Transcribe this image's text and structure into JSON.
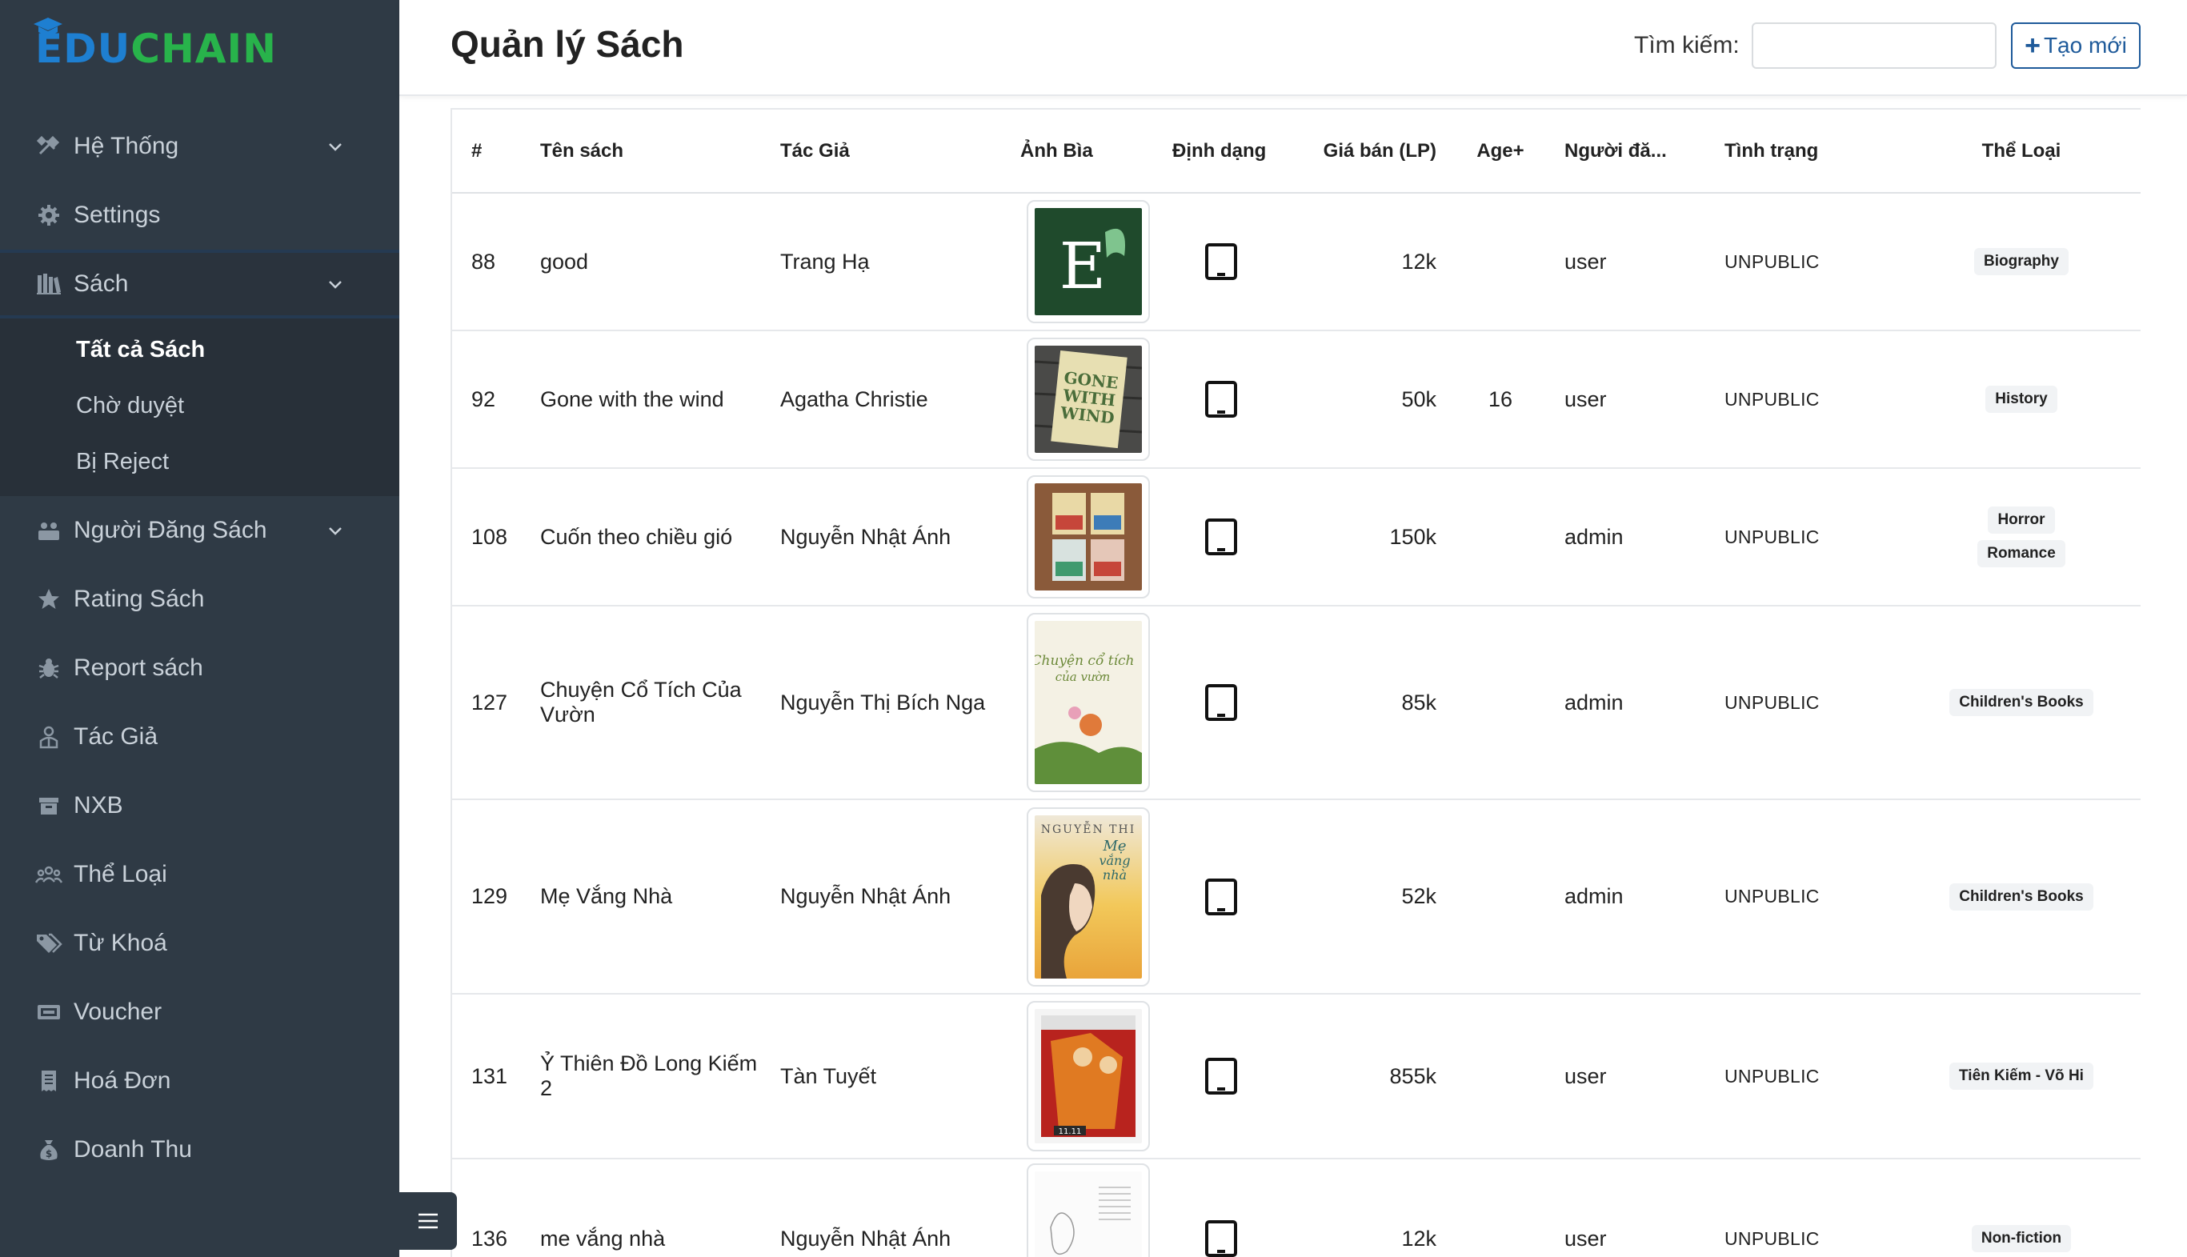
{
  "app": {
    "logo_edu": "EDU",
    "logo_chain": "CHAIN",
    "colors": {
      "sidebar_bg": "#2f3a45",
      "brand_blue": "#1e7fd1",
      "brand_green": "#28b34b",
      "button_border": "#1e5a9a"
    }
  },
  "sidebar": {
    "items": [
      {
        "label": "Hệ Thống",
        "icon": "tools-icon",
        "has_children": true
      },
      {
        "label": "Settings",
        "icon": "gear-icon",
        "has_children": false
      },
      {
        "label": "Sách",
        "icon": "books-icon",
        "has_children": true,
        "open": true,
        "children": [
          {
            "label": "Tất cả Sách",
            "active": true
          },
          {
            "label": "Chờ duyệt",
            "active": false
          },
          {
            "label": "Bị Reject",
            "active": false
          }
        ]
      },
      {
        "label": "Người Đăng Sách",
        "icon": "user-group-icon",
        "has_children": true
      },
      {
        "label": "Rating Sách",
        "icon": "star-icon",
        "has_children": false
      },
      {
        "label": "Report sách",
        "icon": "bug-icon",
        "has_children": false
      },
      {
        "label": "Tác Giả",
        "icon": "author-icon",
        "has_children": false
      },
      {
        "label": "NXB",
        "icon": "archive-icon",
        "has_children": false
      },
      {
        "label": "Thể Loại",
        "icon": "people-icon",
        "has_children": false
      },
      {
        "label": "Từ Khoá",
        "icon": "tags-icon",
        "has_children": false
      },
      {
        "label": "Voucher",
        "icon": "voucher-icon",
        "has_children": false
      },
      {
        "label": "Hoá Đơn",
        "icon": "receipt-icon",
        "has_children": false
      },
      {
        "label": "Doanh Thu",
        "icon": "money-bag-icon",
        "has_children": false
      }
    ]
  },
  "header": {
    "title": "Quản lý Sách",
    "search_label": "Tìm kiếm:",
    "search_value": "",
    "create_label": "Tạo mới"
  },
  "table": {
    "columns": [
      "#",
      "Tên sách",
      "Tác Giả",
      "Ảnh Bìa",
      "Định dạng",
      "Giá bán (LP)",
      "Age+",
      "Người đă...",
      "Tình trạng",
      "Thể Loại"
    ],
    "rows": [
      {
        "id": "88",
        "title": "good",
        "author": "Trang Hạ",
        "cover_icon": "book-cover-image",
        "format_icon": "tablet-icon",
        "price": "12k",
        "age": "",
        "uploader": "user",
        "status": "UNPUBLIC",
        "genres": [
          "Biography"
        ]
      },
      {
        "id": "92",
        "title": "Gone with the wind",
        "author": "Agatha Christie",
        "cover_icon": "book-cover-image",
        "format_icon": "tablet-icon",
        "price": "50k",
        "age": "16",
        "uploader": "user",
        "status": "UNPUBLIC",
        "genres": [
          "History"
        ]
      },
      {
        "id": "108",
        "title": "Cuốn theo chiều gió",
        "author": "Nguyễn Nhật Ánh",
        "cover_icon": "book-cover-image",
        "format_icon": "tablet-icon",
        "price": "150k",
        "age": "",
        "uploader": "admin",
        "status": "UNPUBLIC",
        "genres": [
          "Horror",
          "Romance"
        ]
      },
      {
        "id": "127",
        "title": "Chuyện Cổ Tích Của Vườn",
        "author": "Nguyễn Thị Bích Nga",
        "cover_icon": "book-cover-image",
        "format_icon": "tablet-icon",
        "price": "85k",
        "age": "",
        "uploader": "admin",
        "status": "UNPUBLIC",
        "genres": [
          "Children's Books"
        ]
      },
      {
        "id": "129",
        "title": "Mẹ Vắng Nhà",
        "author": "Nguyễn Nhật Ánh",
        "cover_icon": "book-cover-image",
        "format_icon": "tablet-icon",
        "price": "52k",
        "age": "",
        "uploader": "admin",
        "status": "UNPUBLIC",
        "genres": [
          "Children's Books"
        ]
      },
      {
        "id": "131",
        "title": "Ỷ Thiên Đồ Long Kiếm 2",
        "author": "Tàn Tuyết",
        "cover_icon": "book-cover-image",
        "format_icon": "tablet-icon",
        "price": "855k",
        "age": "",
        "uploader": "user",
        "status": "UNPUBLIC",
        "genres": [
          "Tiên Kiếm - Võ Hi"
        ]
      },
      {
        "id": "136",
        "title": "me vắng nhà",
        "author": "Nguyễn Nhật Ánh",
        "cover_icon": "book-cover-image",
        "format_icon": "tablet-icon",
        "price": "12k",
        "age": "",
        "uploader": "user",
        "status": "UNPUBLIC",
        "genres": [
          "Non-fiction"
        ]
      }
    ]
  }
}
